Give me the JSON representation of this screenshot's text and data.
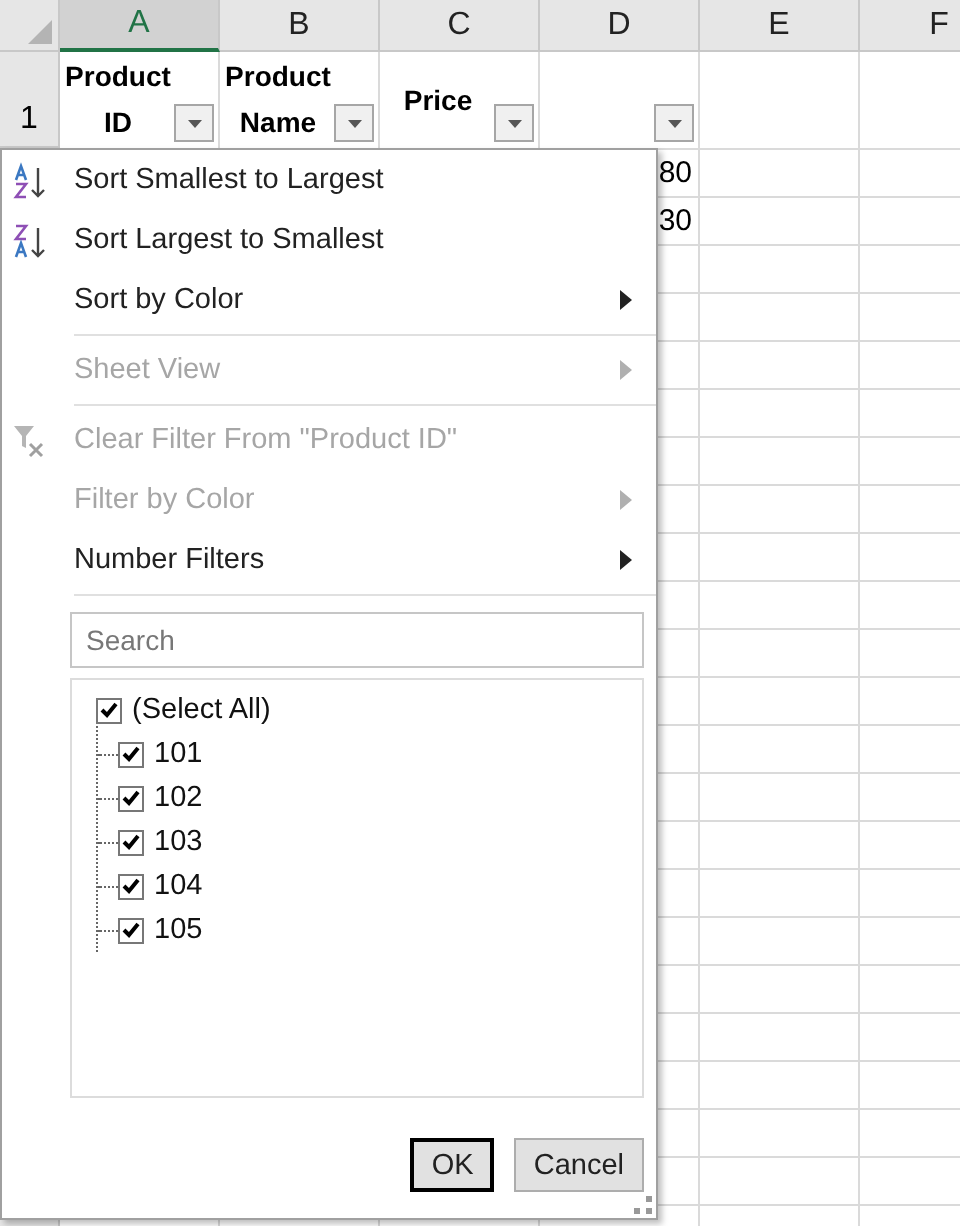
{
  "columns": [
    {
      "letter": "A",
      "selected": true
    },
    {
      "letter": "B",
      "selected": false
    },
    {
      "letter": "C",
      "selected": false
    },
    {
      "letter": "D",
      "selected": false
    },
    {
      "letter": "E",
      "selected": false
    },
    {
      "letter": "F",
      "selected": false
    }
  ],
  "header_row": {
    "number": "1",
    "cells": [
      {
        "kind": "label",
        "label": "Product ID"
      },
      {
        "kind": "label",
        "label": "Product Name"
      },
      {
        "kind": "label",
        "label": "Price"
      },
      {
        "kind": "blank"
      }
    ]
  },
  "rows": [
    {
      "column_d": "80"
    },
    {
      "column_d": "30"
    }
  ],
  "filter_menu": {
    "items": [
      {
        "kind": "sort-ascending",
        "label": "Sort Smallest to Largest",
        "disabled": false,
        "submenu": false
      },
      {
        "kind": "sort-descending",
        "label": "Sort Largest to Smallest",
        "disabled": false,
        "submenu": false
      },
      {
        "kind": "item",
        "label": "Sort by Color",
        "disabled": false,
        "submenu": true
      },
      {
        "kind": "separator"
      },
      {
        "kind": "item",
        "label": "Sheet View",
        "disabled": true,
        "submenu": true
      },
      {
        "kind": "separator"
      },
      {
        "kind": "clear-filter",
        "label": "Clear Filter From \"Product ID\"",
        "disabled": true,
        "submenu": false
      },
      {
        "kind": "item",
        "label": "Filter by Color",
        "disabled": true,
        "submenu": true
      },
      {
        "kind": "item",
        "label": "Number Filters",
        "disabled": false,
        "submenu": true
      },
      {
        "kind": "separator"
      }
    ],
    "search": {
      "placeholder": "Search"
    },
    "checklist": [
      {
        "label": "(Select All)",
        "checked": true,
        "children": [
          {
            "label": "101",
            "checked": true
          },
          {
            "label": "102",
            "checked": true
          },
          {
            "label": "103",
            "checked": true
          },
          {
            "label": "104",
            "checked": true
          },
          {
            "label": "105",
            "checked": true
          }
        ]
      }
    ],
    "buttons": [
      {
        "label": "OK",
        "default": true
      },
      {
        "label": "Cancel",
        "default": false
      }
    ]
  }
}
